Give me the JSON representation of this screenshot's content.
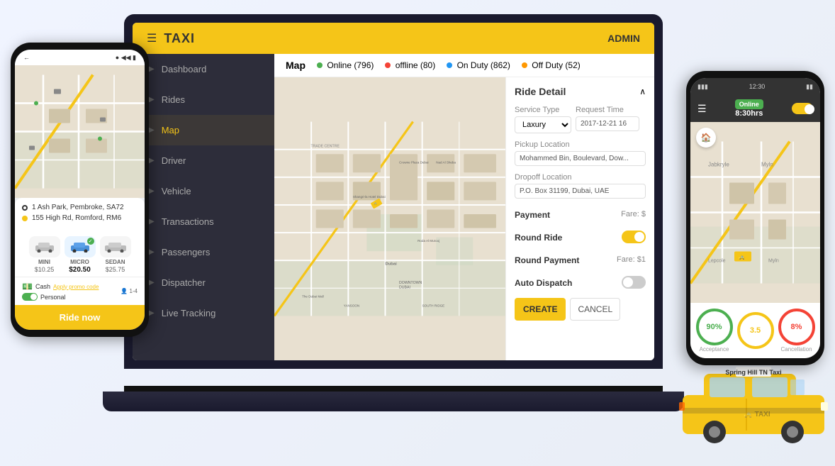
{
  "app": {
    "title": "TAXI",
    "admin_label": "ADMIN",
    "hamburger": "☰"
  },
  "map_bar": {
    "title": "Map",
    "online": "Online (796)",
    "offline": "offline (80)",
    "on_duty": "On Duty (862)",
    "off_duty": "Off Duty (52)"
  },
  "sidebar": {
    "items": [
      {
        "label": "Dashboard",
        "active": false
      },
      {
        "label": "Rides",
        "active": false
      },
      {
        "label": "Map",
        "active": true
      },
      {
        "label": "Driver",
        "active": false
      },
      {
        "label": "Vehicle",
        "active": false
      },
      {
        "label": "Transactions",
        "active": false
      },
      {
        "label": "Passengers",
        "active": false
      },
      {
        "label": "Dispatcher",
        "active": false
      },
      {
        "label": "Live Tracking",
        "active": false
      }
    ]
  },
  "ride_panel": {
    "title": "Ride Detail",
    "service_type_label": "Service Type",
    "request_time_label": "Request Time",
    "service_type_value": "Laxury",
    "request_time_value": "2017-12-21 16",
    "pickup_label": "Pickup Location",
    "pickup_value": "Mohammed Bin, Boulevard, Dow...",
    "dropoff_label": "Dropoff Location",
    "dropoff_value": "P.O. Box 31199, Dubai, UAE",
    "payment_label": "Payment",
    "payment_fare": "Fare: $",
    "round_ride_label": "Round Ride",
    "round_payment_label": "Round Payment",
    "round_payment_fare": "Fare: $1",
    "auto_dispatch_label": "Auto Dispatch",
    "create_btn": "CREATE",
    "cancel_btn": "CANCEL"
  },
  "phone_left": {
    "status_bar": {
      "back": "←",
      "signal": "◀◀◀",
      "wifi": "⌇",
      "battery": "▮▮"
    },
    "address1": "1 Ash Park, Pembroke, SA72",
    "address2": "155 High Rd, Romford, RM6",
    "cars": [
      {
        "name": "MINI",
        "price": "$10.25",
        "selected": false
      },
      {
        "name": "MICRO",
        "price": "$20.50",
        "selected": true
      },
      {
        "name": "SEDAN",
        "price": "$25.75",
        "selected": false
      }
    ],
    "cash_label": "Cash",
    "promo_label": "Apply promo code",
    "personal_label": "Personal",
    "persons": "1-4",
    "ride_now": "Ride now"
  },
  "phone_right": {
    "status": "Online",
    "time": "8:30hrs",
    "time_bar": "12:30",
    "stats": [
      {
        "value": "90%",
        "label": "Acceptance",
        "color": "green"
      },
      {
        "value": "3.5",
        "label": "",
        "color": "yellow"
      },
      {
        "value": "8%",
        "label": "Cancellation",
        "color": "red"
      }
    ]
  }
}
